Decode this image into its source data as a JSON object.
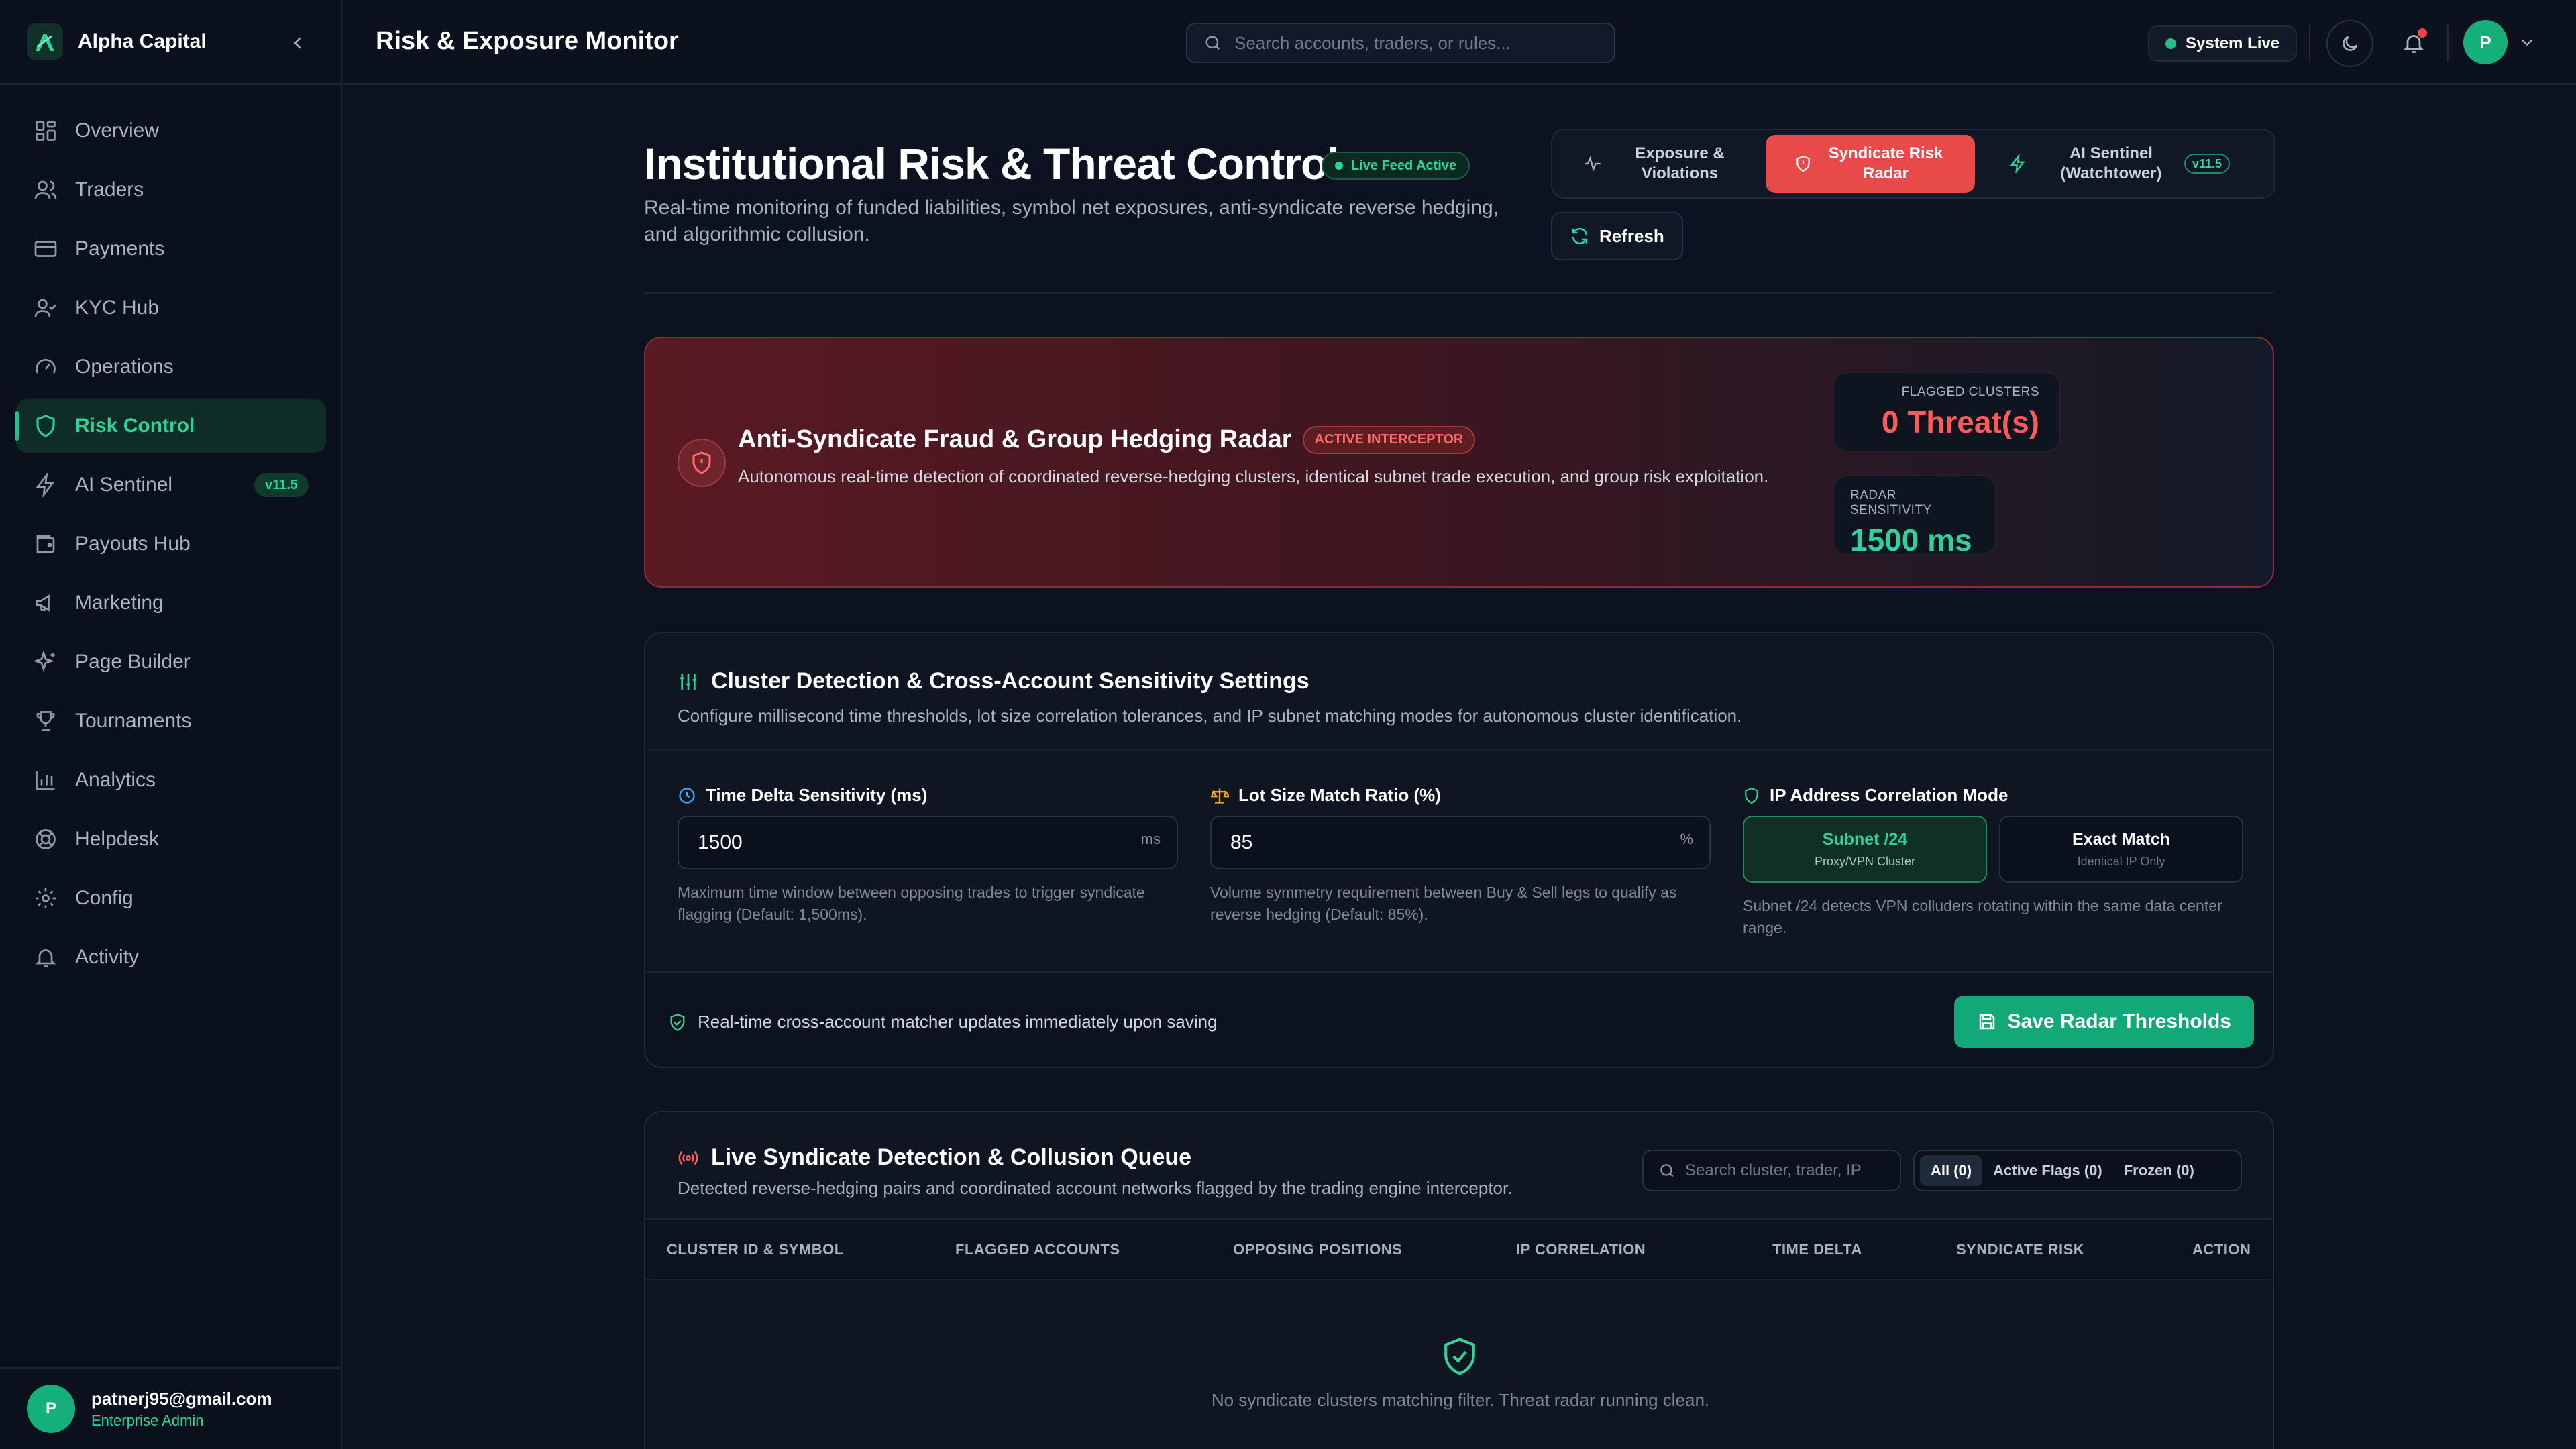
{
  "brand": {
    "name": "Alpha Capital"
  },
  "sidebar": {
    "items": [
      {
        "label": "Overview",
        "icon": "grid-icon"
      },
      {
        "label": "Traders",
        "icon": "users-icon"
      },
      {
        "label": "Payments",
        "icon": "credit-card-icon"
      },
      {
        "label": "KYC Hub",
        "icon": "user-check-icon"
      },
      {
        "label": "Operations",
        "icon": "gauge-icon"
      },
      {
        "label": "Risk Control",
        "icon": "shield-icon",
        "active": true
      },
      {
        "label": "AI Sentinel",
        "icon": "lightning-icon",
        "badge": "v11.5"
      },
      {
        "label": "Payouts Hub",
        "icon": "wallet-icon"
      },
      {
        "label": "Marketing",
        "icon": "megaphone-icon"
      },
      {
        "label": "Page Builder",
        "icon": "sparkles-icon"
      },
      {
        "label": "Tournaments",
        "icon": "trophy-icon"
      },
      {
        "label": "Analytics",
        "icon": "bar-chart-icon"
      },
      {
        "label": "Helpdesk",
        "icon": "lifebuoy-icon"
      },
      {
        "label": "Config",
        "icon": "gear-icon"
      },
      {
        "label": "Activity",
        "icon": "bell-icon"
      }
    ],
    "user": {
      "initial": "P",
      "email": "patnerj95@gmail.com",
      "role": "Enterprise Admin"
    }
  },
  "topbar": {
    "title": "Risk & Exposure Monitor",
    "search_placeholder": "Search accounts, traders, or rules...",
    "status": "System Live",
    "avatar_initial": "P"
  },
  "header": {
    "title": "Institutional Risk & Threat Control",
    "live_badge": "Live Feed Active",
    "subtitle": "Real-time monitoring of funded liabilities, symbol net exposures, anti-syndicate reverse hedging, and algorithmic collusion.",
    "tabs": [
      {
        "label": "Exposure & Violations"
      },
      {
        "label": "Syndicate Risk Radar",
        "active": true
      },
      {
        "label": "AI Sentinel (Watchtower)",
        "badge": "v11.5"
      }
    ],
    "refresh_label": "Refresh"
  },
  "radar": {
    "title": "Anti-Syndicate Fraud & Group Hedging Radar",
    "badge": "ACTIVE INTERCEPTOR",
    "description": "Autonomous real-time detection of coordinated reverse-hedging clusters, identical subnet trade execution, and group risk exploitation.",
    "flagged_label": "FLAGGED CLUSTERS",
    "flagged_value": "0 Threat(s)",
    "sensitivity_label": "RADAR SENSITIVITY",
    "sensitivity_value": "1500 ms"
  },
  "settings": {
    "title": "Cluster Detection & Cross-Account Sensitivity Settings",
    "subtitle": "Configure millisecond time thresholds, lot size correlation tolerances, and IP subnet matching modes for autonomous cluster identification.",
    "time_delta": {
      "label": "Time Delta Sensitivity (ms)",
      "value": "1500",
      "unit": "ms",
      "help": "Maximum time window between opposing trades to trigger syndicate flagging (Default: 1,500ms)."
    },
    "lot_size": {
      "label": "Lot Size Match Ratio (%)",
      "value": "85",
      "unit": "%",
      "help": "Volume symmetry requirement between Buy & Sell legs to qualify as reverse hedging (Default: 85%)."
    },
    "ip_mode": {
      "label": "IP Address Correlation Mode",
      "options": [
        {
          "title": "Subnet /24",
          "sub": "Proxy/VPN Cluster",
          "selected": true
        },
        {
          "title": "Exact Match",
          "sub": "Identical IP Only"
        }
      ],
      "help": "Subnet /24 detects VPN colluders rotating within the same data center range."
    },
    "footer_note": "Real-time cross-account matcher updates immediately upon saving",
    "save_label": "Save Radar Thresholds"
  },
  "queue": {
    "title": "Live Syndicate Detection & Collusion Queue",
    "subtitle": "Detected reverse-hedging pairs and coordinated account networks flagged by the trading engine interceptor.",
    "search_placeholder": "Search cluster, trader, IP",
    "filters": [
      {
        "label": "All (0)",
        "active": true
      },
      {
        "label": "Active Flags (0)"
      },
      {
        "label": "Frozen (0)"
      }
    ],
    "columns": [
      "CLUSTER ID & SYMBOL",
      "FLAGGED ACCOUNTS",
      "OPPOSING POSITIONS",
      "IP CORRELATION",
      "TIME DELTA",
      "SYNDICATE RISK",
      "ACTION"
    ],
    "empty_message": "No syndicate clusters matching filter. Threat radar running clean."
  },
  "colors": {
    "accent": "#22c08a",
    "danger": "#e84a4a",
    "background": "#0c1220"
  }
}
